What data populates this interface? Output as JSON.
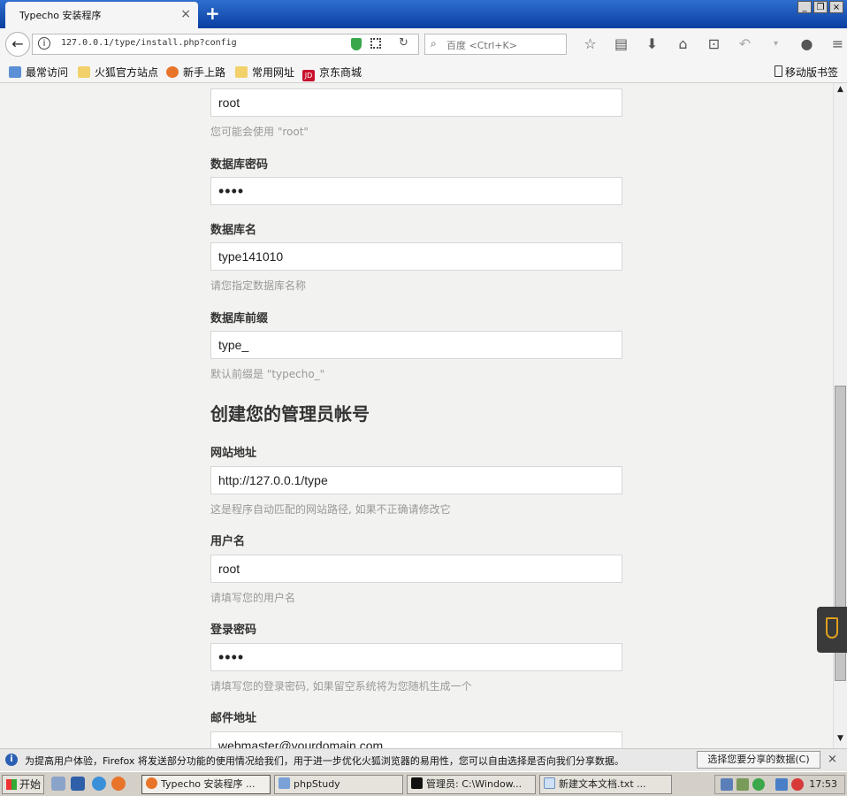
{
  "browser": {
    "tab_title": "Typecho 安装程序",
    "tab_close": "×",
    "new_tab": "+",
    "url": "127.0.0.1/type/install.php?config",
    "search_placeholder": "百度 <Ctrl+K>",
    "window_buttons": [
      "_",
      "❐",
      "×"
    ],
    "bookmarks": [
      {
        "label": "最常访问",
        "color": "#5b8fd6"
      },
      {
        "label": "火狐官方站点",
        "color": "#f2d16b"
      },
      {
        "label": "新手上路",
        "color": "#e8742a"
      },
      {
        "label": "常用网址",
        "color": "#f2d16b"
      },
      {
        "label": "京东商城",
        "color": "#c8102e",
        "icon_text": "JD"
      }
    ],
    "mobile_bookmarks": "移动版书签"
  },
  "form": {
    "db_user_value": "root",
    "db_user_hint": "您可能会使用 \"root\"",
    "db_password_label": "数据库密码",
    "db_password_value": "••••",
    "db_name_label": "数据库名",
    "db_name_value": "type141010",
    "db_name_hint": "请您指定数据库名称",
    "db_prefix_label": "数据库前缀",
    "db_prefix_value": "type_",
    "db_prefix_hint": "默认前缀是 \"typecho_\"",
    "admin_heading": "创建您的管理员帐号",
    "site_url_label": "网站地址",
    "site_url_value": "http://127.0.0.1/type",
    "site_url_hint": "这是程序自动匹配的网站路径, 如果不正确请修改它",
    "username_label": "用户名",
    "username_value": "root",
    "username_hint": "请填写您的用户名",
    "login_password_label": "登录密码",
    "login_password_value": "••••",
    "login_password_hint": "请填写您的登录密码, 如果留空系统将为您随机生成一个",
    "email_label": "邮件地址",
    "email_value": "webmaster@yourdomain.com"
  },
  "notification": {
    "text": "为提高用户体验，Firefox 将发送部分功能的使用情况给我们，用于进一步优化火狐浏览器的易用性，您可以自由选择是否向我们分享数据。",
    "button": "选择您要分享的数据(C)",
    "close": "×"
  },
  "taskbar": {
    "start": "开始",
    "tasks": [
      {
        "label": "Typecho 安装程序 ...",
        "color": "#e8742a"
      },
      {
        "label": "phpStudy",
        "color": "#7aa0d8"
      },
      {
        "label": "管理员: C:\\Window...",
        "color": "#111111"
      },
      {
        "label": "新建文本文档.txt ...",
        "color": "#cfe0f5"
      }
    ],
    "clock": "17:53"
  }
}
